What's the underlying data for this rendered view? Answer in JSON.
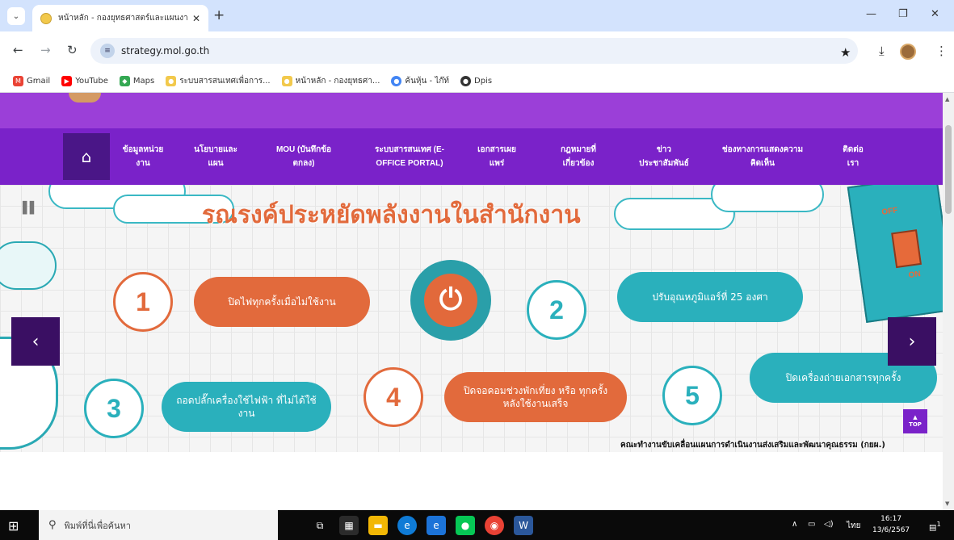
{
  "browser": {
    "tab_title": "หน้าหลัก - กองยุทธศาสตร์และแผนงาน",
    "tab_close": "✕",
    "new_tab": "+",
    "url": "strategy.mol.go.th",
    "bookmarks": [
      {
        "label": "Gmail",
        "color": "#ea4335",
        "icon": "M"
      },
      {
        "label": "YouTube",
        "color": "#ff0000",
        "icon": "▶"
      },
      {
        "label": "Maps",
        "color": "#34a853",
        "icon": "◆"
      },
      {
        "label": "ระบบสารสนเทศเพื่อการ...",
        "color": "#f2c94c",
        "icon": "●"
      },
      {
        "label": "หน้าหลัก - กองยุทธศา...",
        "color": "#f2c94c",
        "icon": "●"
      },
      {
        "label": "ค้นหุ้น - ไก๊ท์",
        "color": "#4285f4",
        "icon": "●"
      },
      {
        "label": "Dpis",
        "color": "#333333",
        "icon": "●"
      }
    ]
  },
  "site": {
    "nav": [
      {
        "line1": "ข้อมูลหน่วย",
        "line2": "งาน"
      },
      {
        "line1": "นโยบายและ",
        "line2": "แผน"
      },
      {
        "line1": "MOU (บันทึกข้อ",
        "line2": "ตกลง)"
      },
      {
        "line1": "ระบบสารสนเทศ (E-",
        "line2": "OFFICE PORTAL)"
      },
      {
        "line1": "เอกสารเผย",
        "line2": "แพร่"
      },
      {
        "line1": "กฎหมายที่",
        "line2": "เกี่ยวข้อง"
      },
      {
        "line1": "ข่าว",
        "line2": "ประชาสัมพันธ์"
      },
      {
        "line1": "ช่องทางการแสดงความ",
        "line2": "คิดเห็น"
      },
      {
        "line1": "ติดต่อ",
        "line2": "เรา"
      }
    ],
    "banner": {
      "headline": "รณรงค์ประหยัดพลังงานในสำนักงาน",
      "steps": [
        {
          "num": "1",
          "text": "ปิดไฟทุกครั้งเมื่อไม่ใช้งาน"
        },
        {
          "num": "2",
          "text": "ปรับอุณหภูมิแอร์ที่ 25 องศา"
        },
        {
          "num": "3",
          "text": "ถอดปลั๊กเครื่องใช้ไฟฟ้า ที่ไม่ได้ใช้งาน"
        },
        {
          "num": "4",
          "text": "ปิดจอคอมช่วงพักเที่ยง หรือ ทุกครั้งหลังใช้งานเสร็จ"
        },
        {
          "num": "5",
          "text": "ปิดเครื่องถ่ายเอกสารทุกครั้ง"
        }
      ],
      "switch_off": "OFF",
      "switch_on": "ON",
      "caption": "คณะทำงานขับเคลื่อนแผนการดำเนินงานส่งเสริมและพัฒนาคุณธรรม (กยผ.)"
    },
    "top_button": "TOP"
  },
  "taskbar": {
    "search_placeholder": "พิมพ์ที่นี่เพื่อค้นหา",
    "lang": "ไทย",
    "time": "16:17",
    "date": "13/6/2567",
    "notif_count": "1"
  },
  "colors": {
    "purple": "#7a22c9",
    "orange": "#e26a3c",
    "teal": "#2ab0bc"
  }
}
